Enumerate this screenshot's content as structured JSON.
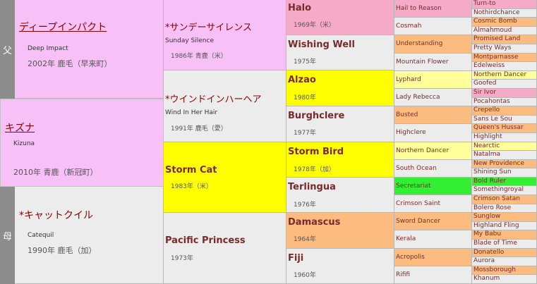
{
  "side": {
    "sire": "父",
    "dam": "母"
  },
  "gen1": [
    {
      "name": "ディープインパクト",
      "eng": "Deep Impact",
      "year": "2002年 鹿毛（早来町）"
    },
    {
      "name": "キズナ",
      "eng": "Kizuna",
      "year": "2010年 青鹿（新冠町）"
    },
    {
      "name": "*キャットクイル",
      "eng": "Catequil",
      "year": "1990年 鹿毛（加）"
    }
  ],
  "gen2": [
    {
      "name": "*サンデーサイレンス",
      "eng": "Sunday Silence",
      "year": "1986年 青鹿（米）"
    },
    {
      "name": "*ウインドインハーヘア",
      "eng": "Wind In Her Hair",
      "year": "1991年 鹿毛（愛）"
    },
    {
      "name": "Storm Cat",
      "eng": "",
      "year": "1983年（米）"
    },
    {
      "name": "Pacific Princess",
      "eng": "",
      "year": "1973年"
    }
  ],
  "gen3": [
    {
      "name": "Halo",
      "year": "1969年（米）"
    },
    {
      "name": "Wishing Well",
      "year": "1975年"
    },
    {
      "name": "Alzao",
      "year": "1980年"
    },
    {
      "name": "Burghclere",
      "year": "1977年"
    },
    {
      "name": "Storm Bird",
      "year": "1978年（加）"
    },
    {
      "name": "Terlingua",
      "year": "1976年"
    },
    {
      "name": "Damascus",
      "year": "1964年"
    },
    {
      "name": "Fiji",
      "year": "1960年"
    }
  ],
  "gen4": [
    "Hail to Reason",
    "Cosmah",
    "Understanding",
    "Mountain Flower",
    "Lyphard",
    "Lady Rebecca",
    "Busted",
    "Highclere",
    "Northern Dancer",
    "South Ocean",
    "Secretariat",
    "Crimson Saint",
    "Sword Dancer",
    "Kerala",
    "Acropolis",
    "Rififi"
  ],
  "gen5": [
    "Turn-to",
    "Nothirdchance",
    "Cosmic Bomb",
    "Almahmoud",
    "Promised Land",
    "Pretty Ways",
    "Montparnasse",
    "Edelweiss",
    "Northern Dancer",
    "Goofed",
    "Sir Ivor",
    "Pocahontas",
    "Crepello",
    "Sans Le Sou",
    "Queen's Hussar",
    "Highlight",
    "Nearctic",
    "Natalma",
    "New Providence",
    "Shining Sun",
    "Bold Ruler",
    "Somethingroyal",
    "Crimson Satan",
    "Bolero Rose",
    "Sunglow",
    "Highland Fling",
    "My Babu",
    "Blade of Time",
    "Donatello",
    "Aurora",
    "Mossborough",
    "Khanum"
  ],
  "colors": {
    "pink": "#f5aac8",
    "lightpink": "#f7c0f7",
    "gray": "#ececec",
    "yellow": "#ffff00",
    "lightyellow": "#ffff99",
    "orange": "#fcbc80",
    "green": "#33ee33",
    "sidebar": "#8c8c8c",
    "name": "#8b0000"
  }
}
